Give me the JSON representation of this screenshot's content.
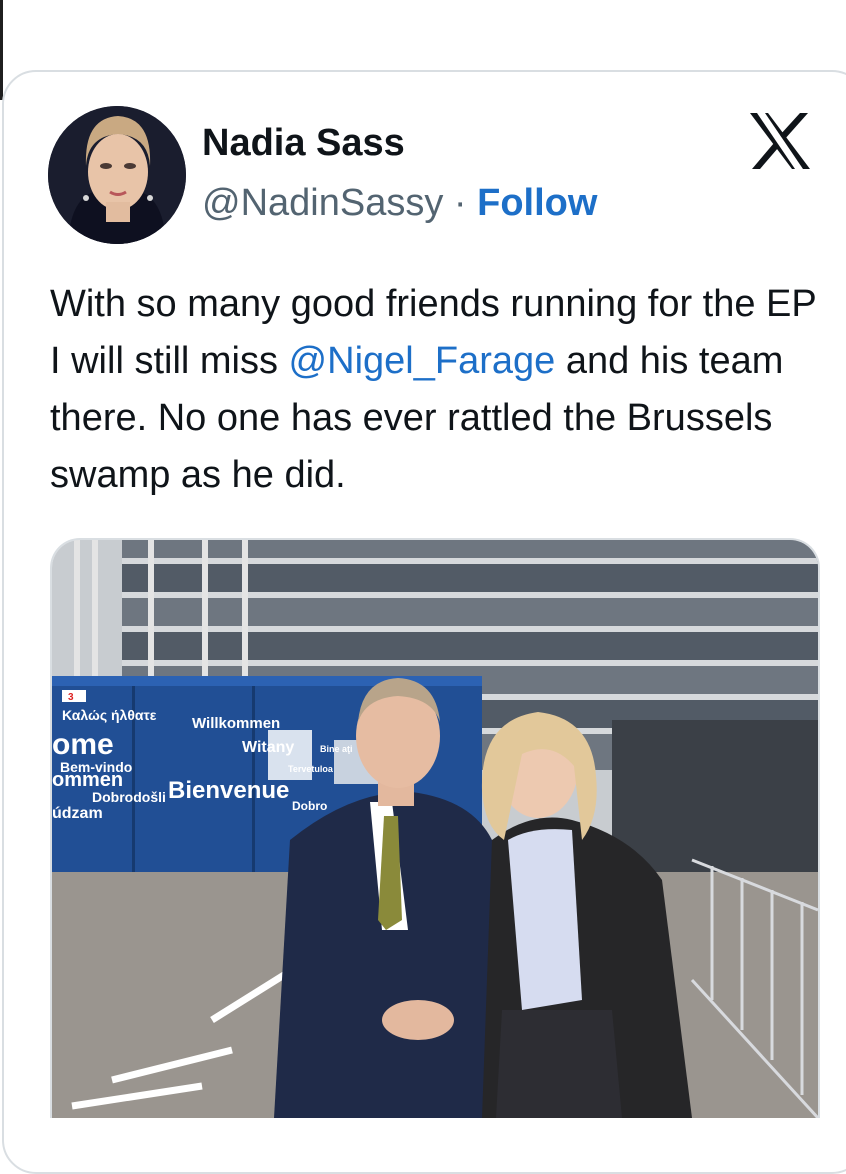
{
  "tweet": {
    "author_name": "Nadia Sass",
    "handle": "@NadinSassy",
    "separator": "·",
    "follow_label": "Follow",
    "text_part1": "With so many good friends running for the EP I will still miss ",
    "mention": "@Nigel_Farage",
    "text_part2": " and his team there. No one has ever rattled the Brussels swamp as he did."
  },
  "photo": {
    "sign_words": [
      "Καλώς ήλθατε",
      "ome",
      "Bem-vindo",
      "ommen",
      "Dobrodošli",
      "údzam",
      "Willkommen",
      "Witany",
      "Bienvenue",
      "Tervetuloa",
      "Bine aţi",
      "Dobro"
    ],
    "sign_number": "3"
  },
  "colors": {
    "accent": "#1d6fc8",
    "text": "#0f1419",
    "muted": "#536471",
    "border": "#d9dee2"
  },
  "icons": {
    "brand": "x-logo-icon"
  }
}
